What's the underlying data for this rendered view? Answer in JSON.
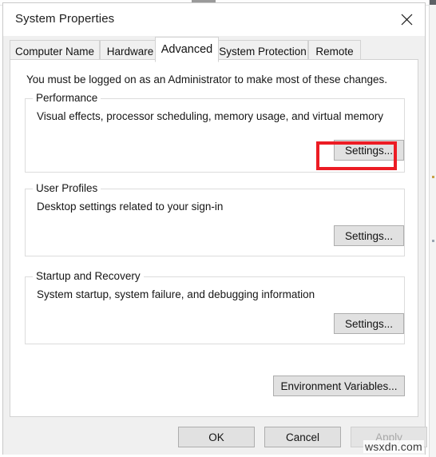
{
  "window": {
    "title": "System Properties",
    "close_icon": "close-icon"
  },
  "tabs": [
    {
      "label": "Computer Name",
      "active": false
    },
    {
      "label": "Hardware",
      "active": false
    },
    {
      "label": "Advanced",
      "active": true
    },
    {
      "label": "System Protection",
      "active": false
    },
    {
      "label": "Remote",
      "active": false
    }
  ],
  "content": {
    "notice": "You must be logged on as an Administrator to make most of these changes.",
    "groups": [
      {
        "legend": "Performance",
        "description": "Visual effects, processor scheduling, memory usage, and virtual memory",
        "button_label": "Settings...",
        "highlighted": true
      },
      {
        "legend": "User Profiles",
        "description": "Desktop settings related to your sign-in",
        "button_label": "Settings...",
        "highlighted": false
      },
      {
        "legend": "Startup and Recovery",
        "description": "System startup, system failure, and debugging information",
        "button_label": "Settings...",
        "highlighted": false
      }
    ],
    "environment_variables_label": "Environment Variables..."
  },
  "footer": {
    "ok_label": "OK",
    "cancel_label": "Cancel",
    "apply_label": "Apply",
    "apply_disabled": true
  },
  "overlay": {
    "watermark": "wsxdn.com",
    "highlight_color": "#ec1c24"
  }
}
